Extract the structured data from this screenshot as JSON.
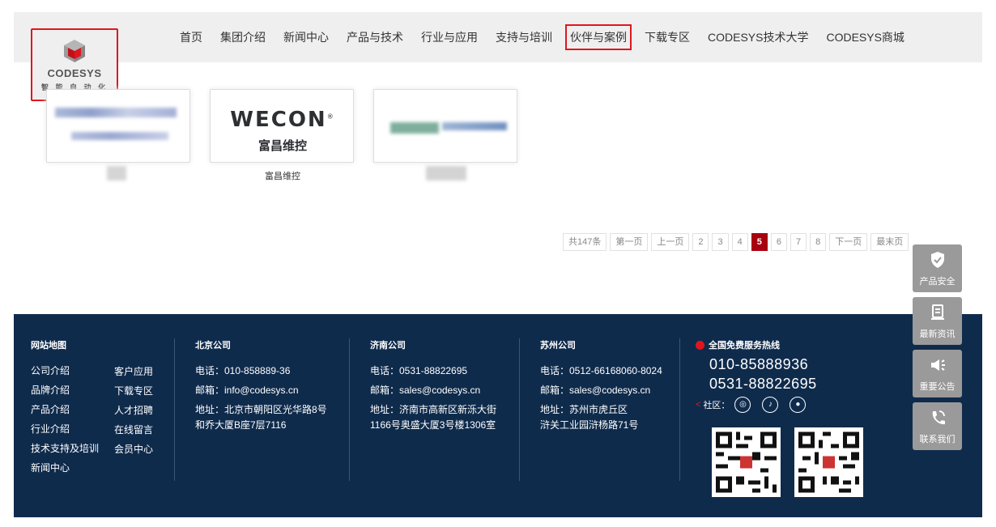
{
  "header": {
    "logo": {
      "name": "CODESYS",
      "tagline": "智 能 自 动 化"
    },
    "nav": [
      "首页",
      "集团介绍",
      "新闻中心",
      "产品与技术",
      "行业与应用",
      "支持与培训",
      "伙伴与案例",
      "下载专区",
      "CODESYS技术大学",
      "CODESYS商城"
    ],
    "active_nav": "伙伴与案例"
  },
  "partners": [
    {
      "caption": "",
      "brand": "",
      "brand_sub": ""
    },
    {
      "caption": "富昌维控",
      "brand": "WECON",
      "brand_sub": "富昌维控"
    },
    {
      "caption": "",
      "brand": "",
      "brand_sub": ""
    }
  ],
  "pagination": {
    "total": "共147条",
    "first": "第一页",
    "prev": "上一页",
    "pages": [
      "2",
      "3",
      "4",
      "5",
      "6",
      "7",
      "8"
    ],
    "current": "5",
    "next": "下一页",
    "last": "最末页"
  },
  "side_tools": [
    {
      "label": "产品安全",
      "icon": "shield-icon"
    },
    {
      "label": "最新资讯",
      "icon": "document-icon"
    },
    {
      "label": "重要公告",
      "icon": "megaphone-icon"
    },
    {
      "label": "联系我们",
      "icon": "phone-icon"
    }
  ],
  "footer": {
    "sitemap": {
      "title": "网站地图",
      "col1": [
        "公司介绍",
        "品牌介绍",
        "产品介绍",
        "行业介绍",
        "技术支持及培训",
        "新闻中心"
      ],
      "col2": [
        "客户应用",
        "下载专区",
        "人才招聘",
        "在线留言",
        "会员中心"
      ]
    },
    "offices": [
      {
        "title": "北京公司",
        "phone": "电话：010-858889-36",
        "email": "邮箱：info@codesys.cn",
        "addr1": "地址：北京市朝阳区光华路8号",
        "addr2": "和乔大厦B座7层7116"
      },
      {
        "title": "济南公司",
        "phone": "电话：0531-88822695",
        "email": "邮箱：sales@codesys.cn",
        "addr1": "地址：济南市高新区新泺大街",
        "addr2": "1166号奥盛大厦3号楼1306室"
      },
      {
        "title": "苏州公司",
        "phone": "电话：0512-66168060-8024",
        "email": "邮箱：sales@codesys.cn",
        "addr1": "地址：苏州市虎丘区",
        "addr2": "浒关工业园浒杨路71号"
      }
    ],
    "hotline": {
      "title": "全国免费服务热线",
      "numbers": [
        "010-85888936",
        "0531-88822695"
      ],
      "community": "社区："
    },
    "colors": {
      "bg": "#0f2b4c",
      "accent": "#e0161d",
      "page_active": "#a8000f"
    }
  }
}
